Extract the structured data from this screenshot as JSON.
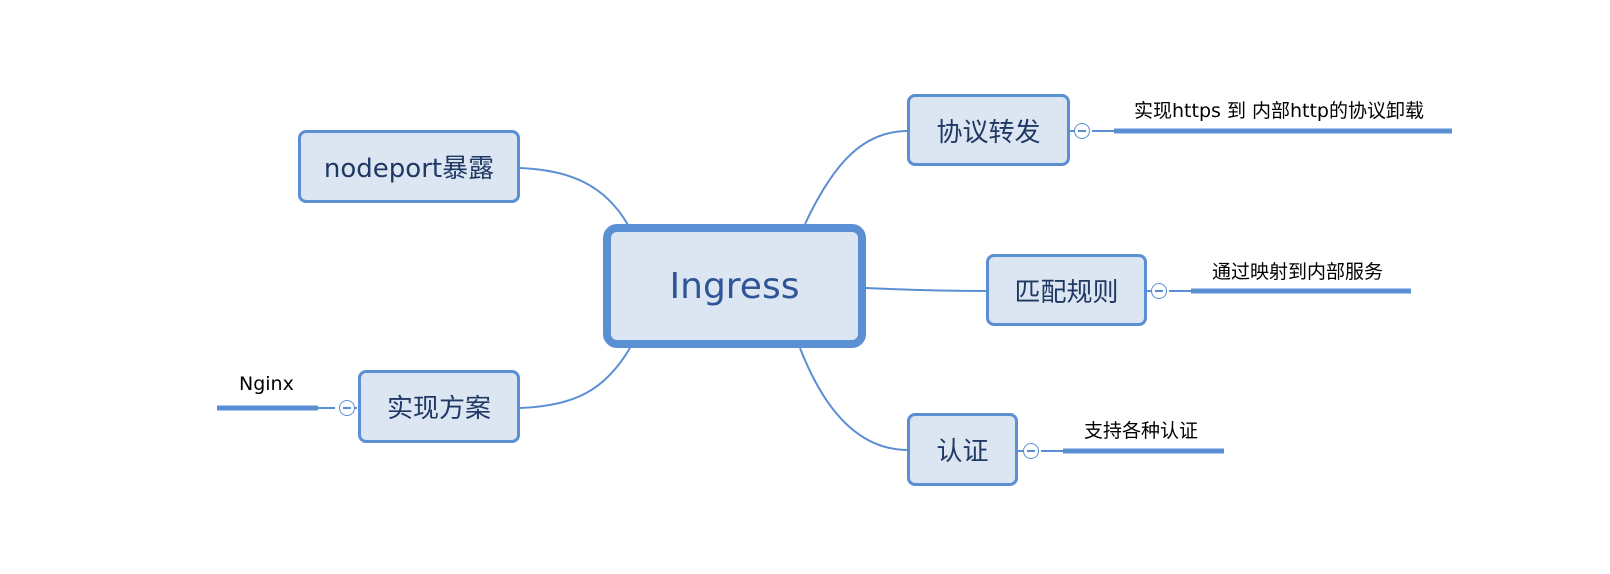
{
  "diagram": {
    "central": "Ingress",
    "branches": {
      "nodeport": "nodeport暴露",
      "implementation": "实现方案",
      "protocol": "协议转发",
      "matching": "匹配规则",
      "auth": "认证"
    },
    "details": {
      "implementation": "Nginx",
      "protocol": "实现https 到 内部http的协议卸载",
      "matching": "通过映射到内部服务",
      "auth": "支持各种认证"
    }
  },
  "colors": {
    "line": "#5b8fd4",
    "node_fill": "#dce6f2",
    "node_text": "#1f3864",
    "central_text": "#2f5597"
  }
}
